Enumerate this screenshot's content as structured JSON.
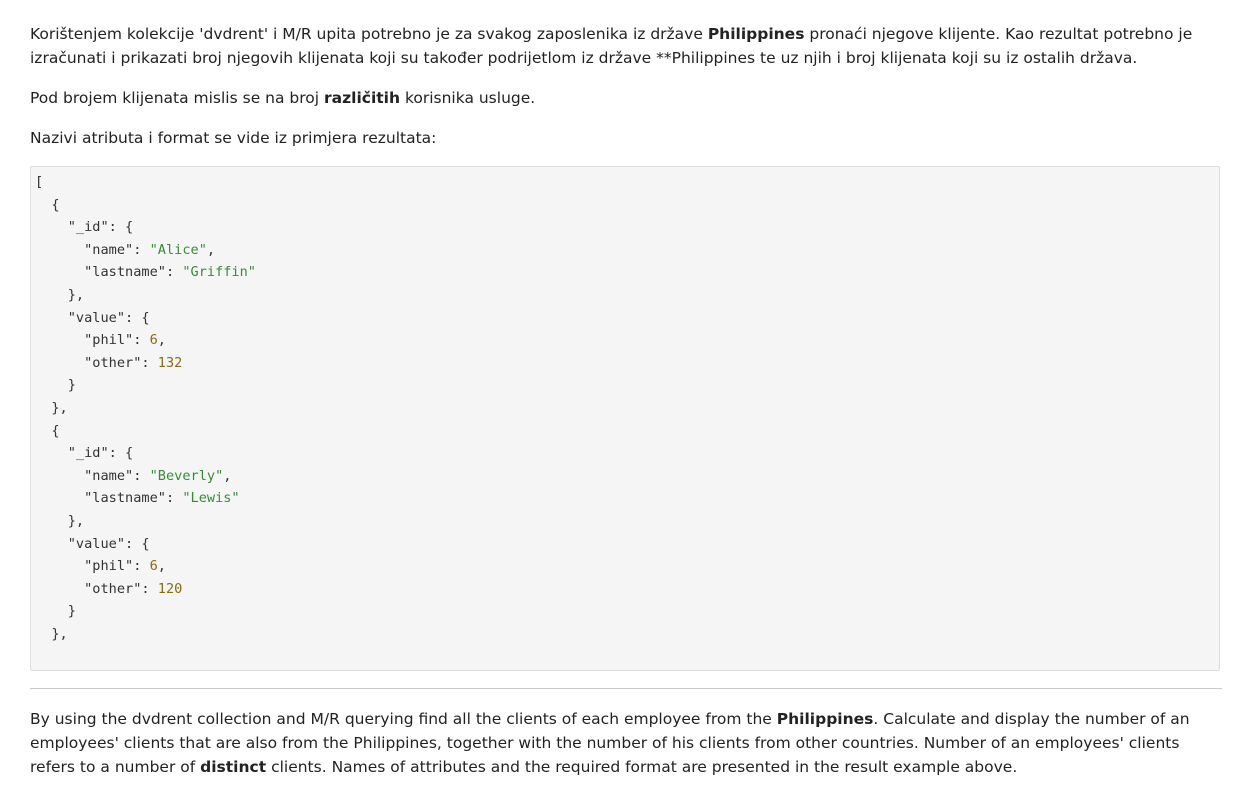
{
  "intro_hr": {
    "part1": "Korištenjem kolekcije 'dvdrent' i M/R upita potrebno je za svakog zaposlenika iz države ",
    "bold1": "Philippines",
    "part2": " pronaći njegove klijente. Kao rezultat potrebno je izračunati i prikazati broj njegovih klijenata koji su također podrijetlom iz države **Philippines te uz njih i broj klijenata koji su iz ostalih država."
  },
  "distinct_hr": {
    "part1": "Pod brojem klijenata mislis se na broj ",
    "bold1": "različitih",
    "part2": " korisnika usluge."
  },
  "format_hr": "Nazivi atributa i format se vide iz primjera rezultata:",
  "code_example": [
    {
      "name": "Alice",
      "lastname": "Griffin",
      "phil": 6,
      "other": 132
    },
    {
      "name": "Beverly",
      "lastname": "Lewis",
      "phil": 6,
      "other": 120
    }
  ],
  "intro_en": {
    "part1": "By using the dvdrent collection and M/R querying find all the clients of each employee from the ",
    "bold1": "Philippines",
    "part2": ". Calculate and display the number of an employees' clients that are also from the Philippines, together with the number of his clients from other countries. Number of an employees' clients refers to a number of ",
    "bold2": "distinct",
    "part3": " clients. Names of attributes and the required format are presented in the result example above."
  }
}
